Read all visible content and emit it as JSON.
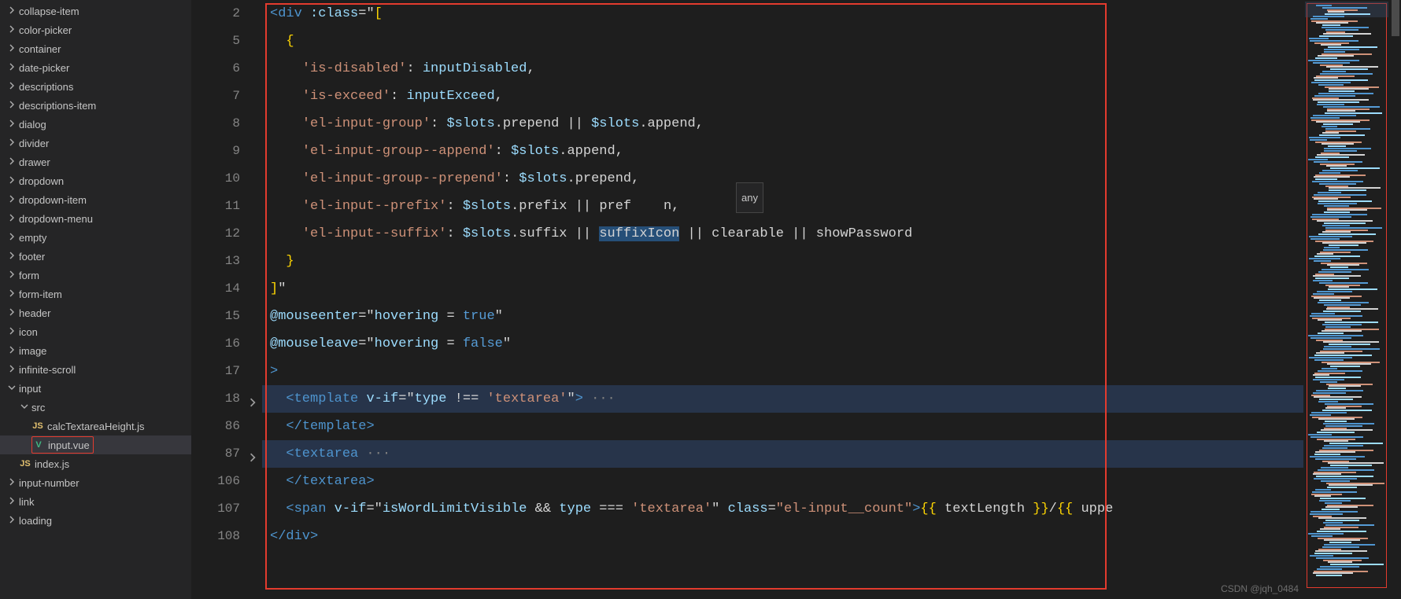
{
  "sidebar": {
    "items": [
      {
        "label": "collapse-item",
        "type": "folder",
        "expanded": false,
        "depth": 0
      },
      {
        "label": "color-picker",
        "type": "folder",
        "expanded": false,
        "depth": 0
      },
      {
        "label": "container",
        "type": "folder",
        "expanded": false,
        "depth": 0
      },
      {
        "label": "date-picker",
        "type": "folder",
        "expanded": false,
        "depth": 0
      },
      {
        "label": "descriptions",
        "type": "folder",
        "expanded": false,
        "depth": 0
      },
      {
        "label": "descriptions-item",
        "type": "folder",
        "expanded": false,
        "depth": 0
      },
      {
        "label": "dialog",
        "type": "folder",
        "expanded": false,
        "depth": 0
      },
      {
        "label": "divider",
        "type": "folder",
        "expanded": false,
        "depth": 0
      },
      {
        "label": "drawer",
        "type": "folder",
        "expanded": false,
        "depth": 0
      },
      {
        "label": "dropdown",
        "type": "folder",
        "expanded": false,
        "depth": 0
      },
      {
        "label": "dropdown-item",
        "type": "folder",
        "expanded": false,
        "depth": 0
      },
      {
        "label": "dropdown-menu",
        "type": "folder",
        "expanded": false,
        "depth": 0
      },
      {
        "label": "empty",
        "type": "folder",
        "expanded": false,
        "depth": 0
      },
      {
        "label": "footer",
        "type": "folder",
        "expanded": false,
        "depth": 0
      },
      {
        "label": "form",
        "type": "folder",
        "expanded": false,
        "depth": 0
      },
      {
        "label": "form-item",
        "type": "folder",
        "expanded": false,
        "depth": 0
      },
      {
        "label": "header",
        "type": "folder",
        "expanded": false,
        "depth": 0
      },
      {
        "label": "icon",
        "type": "folder",
        "expanded": false,
        "depth": 0
      },
      {
        "label": "image",
        "type": "folder",
        "expanded": false,
        "depth": 0
      },
      {
        "label": "infinite-scroll",
        "type": "folder",
        "expanded": false,
        "depth": 0
      },
      {
        "label": "input",
        "type": "folder",
        "expanded": true,
        "depth": 0
      },
      {
        "label": "src",
        "type": "folder",
        "expanded": true,
        "depth": 1
      },
      {
        "label": "calcTextareaHeight.js",
        "type": "file-js",
        "depth": 2
      },
      {
        "label": "input.vue",
        "type": "file-vue",
        "depth": 2,
        "selected": true,
        "selectedRow": true
      },
      {
        "label": "index.js",
        "type": "file-js",
        "depth": 1
      },
      {
        "label": "input-number",
        "type": "folder",
        "expanded": false,
        "depth": 0
      },
      {
        "label": "link",
        "type": "folder",
        "expanded": false,
        "depth": 0
      },
      {
        "label": "loading",
        "type": "folder",
        "expanded": false,
        "depth": 0
      }
    ]
  },
  "editor": {
    "lines": [
      {
        "num": "2",
        "kind": "code",
        "tokens": [
          [
            "tag",
            "<div "
          ],
          [
            "attr",
            ":class"
          ],
          [
            "punct",
            "="
          ],
          [
            "punct",
            "\""
          ],
          [
            "brace",
            "["
          ]
        ]
      },
      {
        "num": "5",
        "kind": "code",
        "tokens": [
          [
            "pad",
            "  "
          ],
          [
            "brace",
            "{"
          ]
        ]
      },
      {
        "num": "6",
        "kind": "code",
        "tokens": [
          [
            "pad",
            "    "
          ],
          [
            "str",
            "'is-disabled'"
          ],
          [
            "punct",
            ": "
          ],
          [
            "ident",
            "inputDisabled"
          ],
          [
            "punct",
            ","
          ]
        ]
      },
      {
        "num": "7",
        "kind": "code",
        "tokens": [
          [
            "pad",
            "    "
          ],
          [
            "str",
            "'is-exceed'"
          ],
          [
            "punct",
            ": "
          ],
          [
            "ident",
            "inputExceed"
          ],
          [
            "punct",
            ","
          ]
        ]
      },
      {
        "num": "8",
        "kind": "code",
        "tokens": [
          [
            "pad",
            "    "
          ],
          [
            "str",
            "'el-input-group'"
          ],
          [
            "punct",
            ": "
          ],
          [
            "ident",
            "$slots"
          ],
          [
            "punct",
            "."
          ],
          [
            "ident2",
            "prepend"
          ],
          [
            "punct",
            " || "
          ],
          [
            "ident",
            "$slots"
          ],
          [
            "punct",
            "."
          ],
          [
            "ident2",
            "append"
          ],
          [
            "punct",
            ","
          ]
        ]
      },
      {
        "num": "9",
        "kind": "code",
        "tokens": [
          [
            "pad",
            "    "
          ],
          [
            "str",
            "'el-input-group--append'"
          ],
          [
            "punct",
            ": "
          ],
          [
            "ident",
            "$slots"
          ],
          [
            "punct",
            "."
          ],
          [
            "ident2",
            "append"
          ],
          [
            "punct",
            ","
          ]
        ]
      },
      {
        "num": "10",
        "kind": "code",
        "tokens": [
          [
            "pad",
            "    "
          ],
          [
            "str",
            "'el-input-group--prepend'"
          ],
          [
            "punct",
            ": "
          ],
          [
            "ident",
            "$slots"
          ],
          [
            "punct",
            "."
          ],
          [
            "ident2",
            "prepend"
          ],
          [
            "punct",
            ","
          ]
        ]
      },
      {
        "num": "11",
        "kind": "code",
        "tokens": [
          [
            "pad",
            "    "
          ],
          [
            "str",
            "'el-input--prefix'"
          ],
          [
            "punct",
            ": "
          ],
          [
            "ident",
            "$slots"
          ],
          [
            "punct",
            "."
          ],
          [
            "ident2",
            "prefix"
          ],
          [
            "punct",
            " || "
          ],
          [
            "ident2",
            "pref"
          ],
          [
            "pad",
            "    "
          ],
          [
            "ident2",
            "n"
          ],
          [
            "punct",
            ","
          ]
        ]
      },
      {
        "num": "12",
        "kind": "code",
        "tokens": [
          [
            "pad",
            "    "
          ],
          [
            "str",
            "'el-input--suffix'"
          ],
          [
            "punct",
            ": "
          ],
          [
            "ident",
            "$slots"
          ],
          [
            "punct",
            "."
          ],
          [
            "ident2",
            "suffix"
          ],
          [
            "punct",
            " || "
          ],
          [
            "sel",
            "suffixIcon"
          ],
          [
            "punct",
            " || "
          ],
          [
            "ident2",
            "clearable"
          ],
          [
            "punct",
            " || "
          ],
          [
            "ident2",
            "showPassword"
          ]
        ]
      },
      {
        "num": "13",
        "kind": "code",
        "tokens": [
          [
            "pad",
            "  "
          ],
          [
            "brace",
            "}"
          ]
        ]
      },
      {
        "num": "14",
        "kind": "code",
        "tokens": [
          [
            "brace",
            "]"
          ],
          [
            "punct",
            "\""
          ]
        ]
      },
      {
        "num": "15",
        "kind": "code",
        "tokens": [
          [
            "attr",
            "@mouseenter"
          ],
          [
            "punct",
            "="
          ],
          [
            "punct",
            "\""
          ],
          [
            "ident",
            "hovering"
          ],
          [
            "punct",
            " = "
          ],
          [
            "kw",
            "true"
          ],
          [
            "punct",
            "\""
          ]
        ]
      },
      {
        "num": "16",
        "kind": "code",
        "tokens": [
          [
            "attr",
            "@mouseleave"
          ],
          [
            "punct",
            "="
          ],
          [
            "punct",
            "\""
          ],
          [
            "ident",
            "hovering"
          ],
          [
            "punct",
            " = "
          ],
          [
            "kw",
            "false"
          ],
          [
            "punct",
            "\""
          ]
        ]
      },
      {
        "num": "17",
        "kind": "code",
        "tokens": [
          [
            "tag",
            ">"
          ]
        ]
      },
      {
        "num": "18",
        "kind": "code",
        "fold": true,
        "hl": true,
        "tokens": [
          [
            "pad",
            "  "
          ],
          [
            "tag",
            "<"
          ],
          [
            "tag",
            "template "
          ],
          [
            "attr",
            "v-if"
          ],
          [
            "punct",
            "="
          ],
          [
            "punct",
            "\""
          ],
          [
            "ident",
            "type"
          ],
          [
            "punct",
            " !== "
          ],
          [
            "str",
            "'textarea'"
          ],
          [
            "punct",
            "\""
          ],
          [
            "tag",
            ">"
          ],
          [
            "dots",
            " ···"
          ]
        ]
      },
      {
        "num": "86",
        "kind": "code",
        "tokens": [
          [
            "pad",
            "  "
          ],
          [
            "tag",
            "</"
          ],
          [
            "tag",
            "template"
          ],
          [
            "tag",
            ">"
          ]
        ]
      },
      {
        "num": "87",
        "kind": "code",
        "fold": true,
        "hl": true,
        "tokens": [
          [
            "pad",
            "  "
          ],
          [
            "tag",
            "<"
          ],
          [
            "tag",
            "textarea"
          ],
          [
            "dots",
            " ···"
          ]
        ]
      },
      {
        "num": "106",
        "kind": "code",
        "tokens": [
          [
            "pad",
            "  "
          ],
          [
            "tag",
            "</"
          ],
          [
            "tag",
            "textarea"
          ],
          [
            "tag",
            ">"
          ]
        ]
      },
      {
        "num": "107",
        "kind": "code",
        "tokens": [
          [
            "pad",
            "  "
          ],
          [
            "tag",
            "<"
          ],
          [
            "tag",
            "span "
          ],
          [
            "attr",
            "v-if"
          ],
          [
            "punct",
            "="
          ],
          [
            "punct",
            "\""
          ],
          [
            "ident",
            "isWordLimitVisible"
          ],
          [
            "punct",
            " && "
          ],
          [
            "ident",
            "type"
          ],
          [
            "punct",
            " === "
          ],
          [
            "str",
            "'textarea'"
          ],
          [
            "punct",
            "\" "
          ],
          [
            "attr",
            "class"
          ],
          [
            "punct",
            "="
          ],
          [
            "str",
            "\"el-input__count\""
          ],
          [
            "tag",
            ">"
          ],
          [
            "brace",
            "{{"
          ],
          [
            "ident2",
            " textLength "
          ],
          [
            "brace",
            "}}"
          ],
          [
            "punct",
            "/"
          ],
          [
            "brace",
            "{{"
          ],
          [
            "ident2",
            " uppe"
          ]
        ]
      },
      {
        "num": "108",
        "kind": "code",
        "tokens": [
          [
            "tag",
            "</div>"
          ]
        ]
      }
    ],
    "tooltip": "any"
  },
  "watermark": "CSDN @jqh_0484"
}
